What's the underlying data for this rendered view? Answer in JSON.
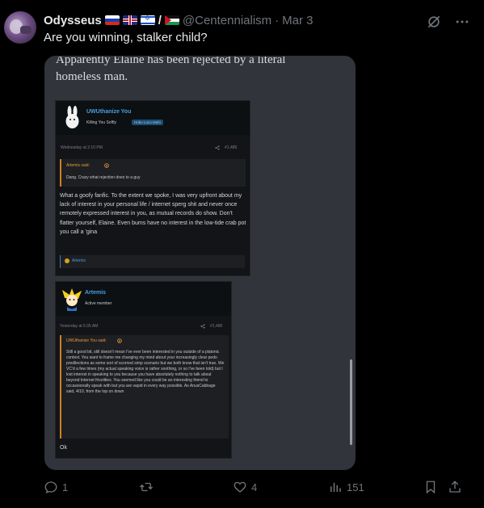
{
  "tweet": {
    "display_name": "Odysseus",
    "flag_separator": "/",
    "handle": "@Centennialism",
    "dot": "·",
    "date": "Mar 3",
    "text": "Are you winning, stalker child?"
  },
  "media": {
    "caption": "Apparently Elaine has been rejected by a literal homeless man.",
    "post1": {
      "username": "UWUthanize You",
      "user_title": "Killing You Softly",
      "user_badge": "Hobo Loco Mofo",
      "timestamp": "Wednesday at 2:10 PM",
      "post_number": "#1,485",
      "quote_title": "Artemis said:",
      "quote_text": "Dang. Crazy what rejection does to a guy",
      "body": "What a goofy fanfic. To the extent we spoke, I was very upfront about my lack of interest in your personal life / internet sperg shit and never once remotely expressed interest in you, as mutual records do show. Don't flatter yourself, Elaine. Even bums have no interest in the low-tide crab pot you call a 'gina",
      "reaction_name": "Artemis"
    },
    "post2": {
      "username": "Artemis",
      "user_title": "Active member",
      "timestamp": "Yesterday at 5:35 AM",
      "post_number": "#1,490",
      "quote_title": "UWUthanize You said:",
      "quote_text": "Still a good bit, still doesn't mean I've ever been interested in you outside of a platonic context. You want to frame me changing my mind about your increasingly clear pedo predilections as some sort of scorned simp scenario but we both know that isn't true. We VC'd a few times (my actual speaking voice is rather soothing, or so I've been told) but I lost interest in speaking to you because you have absolutely nothing to talk about beyond Internet frivolities. You seemed like you could be an interesting friend to occassionally speak with but you are vapid in every way possible. As AnusCabbage said, 4/10, from the top on down",
      "body": "Ok"
    }
  },
  "actions": {
    "replies": "1",
    "reposts": "",
    "likes": "4",
    "views": "151"
  },
  "colors": {
    "background": "#000000",
    "text": "#e7e9ea",
    "muted": "#71767b",
    "quote_accent": "#d17f1e",
    "username_link": "#4a9fe0"
  },
  "icons": {
    "grok": "grok-icon",
    "more": "more-icon",
    "reply": "reply-icon",
    "repost": "repost-icon",
    "like": "heart-icon",
    "views": "views-icon",
    "bookmark": "bookmark-icon",
    "share": "share-icon"
  }
}
